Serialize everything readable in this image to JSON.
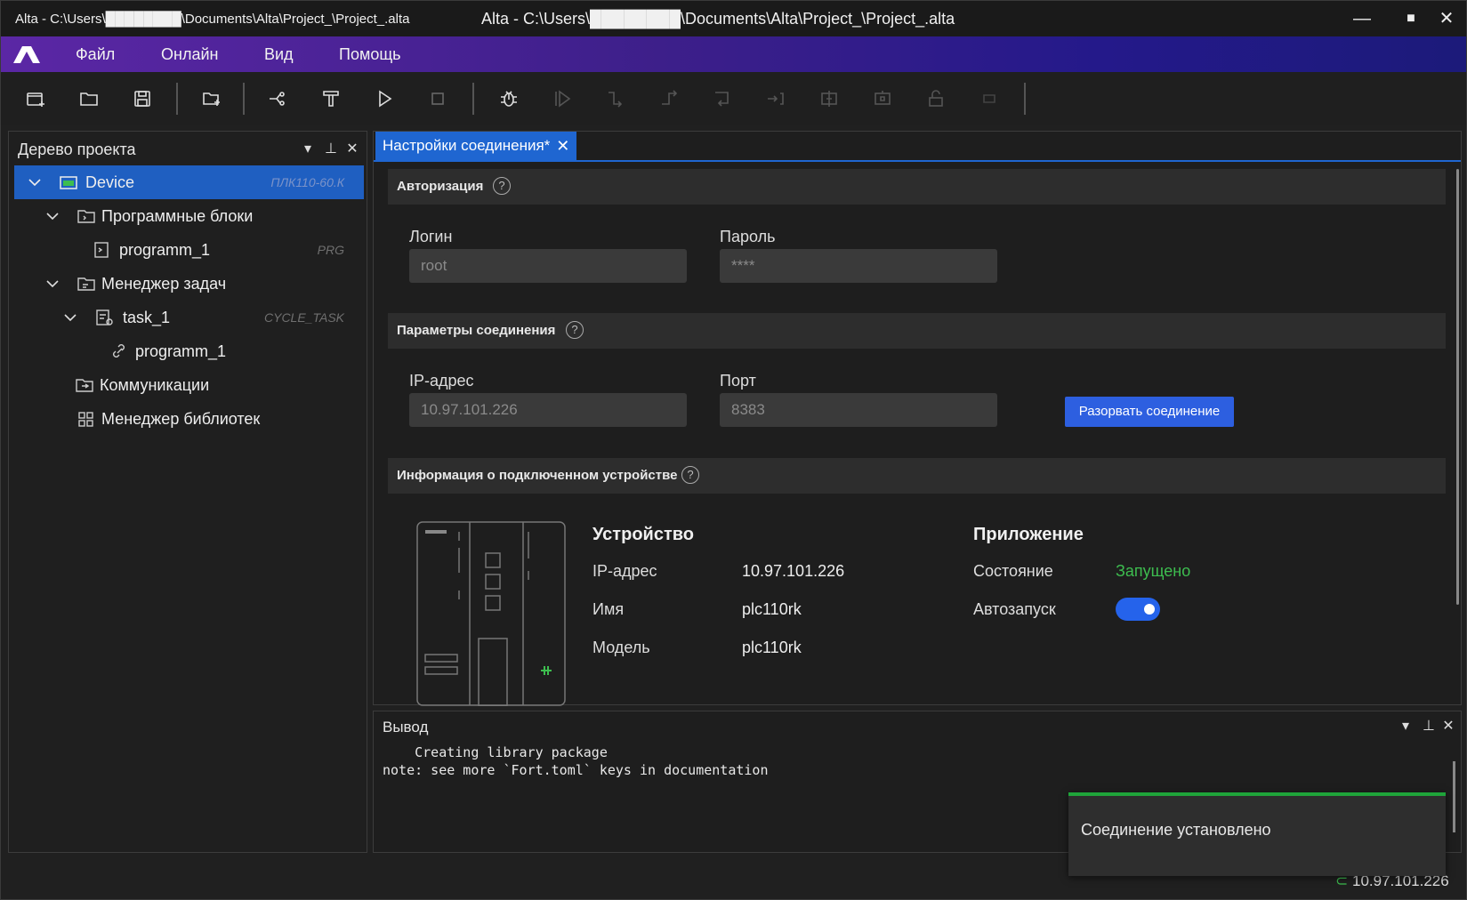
{
  "window": {
    "title_left": "Alta - C:\\Users\\████████\\Documents\\Alta\\Project_\\Project_.alta",
    "title_center": "Alta - C:\\Users\\████████\\Documents\\Alta\\Project_\\Project_.alta",
    "minimize": "—",
    "maximize": "■",
    "close": "✕"
  },
  "menu": {
    "items": [
      "Файл",
      "Онлайн",
      "Вид",
      "Помощь"
    ]
  },
  "toolbar": {
    "icons": [
      "new-project-icon",
      "open-folder-icon",
      "save-icon",
      "add-item-icon",
      "build-icon",
      "format-icon",
      "run-icon",
      "stop-icon",
      "debug-icon",
      "step-play-icon",
      "step-over-icon",
      "step-out-icon",
      "step-into-icon",
      "run-to-cursor-icon",
      "breakpoint-icon",
      "force-value-icon",
      "unlock-icon",
      "more-icon"
    ]
  },
  "project_tree": {
    "title": "Дерево проекта",
    "items": [
      {
        "label": "Device",
        "type": "ПЛК110-60.К"
      },
      {
        "label": "Программные блоки",
        "type": ""
      },
      {
        "label": "programm_1",
        "type": "PRG"
      },
      {
        "label": "Менеджер задач",
        "type": ""
      },
      {
        "label": "task_1",
        "type": "CYCLE_TASK"
      },
      {
        "label": "programm_1",
        "type": ""
      },
      {
        "label": "Коммуникации",
        "type": ""
      },
      {
        "label": "Менеджер библиотек",
        "type": ""
      }
    ]
  },
  "editor": {
    "tab": "Настройки соединения*",
    "tab_close": "✕",
    "help": "?",
    "auth": {
      "title": "Авторизация",
      "login_label": "Логин",
      "login_value": "root",
      "password_label": "Пароль",
      "password_value": "****"
    },
    "connection": {
      "title": "Параметры соединения",
      "ip_label": "IP-адрес",
      "ip_value": "10.97.101.226",
      "port_label": "Порт",
      "port_value": "8383",
      "disconnect_button": "Разорвать соединение"
    },
    "device_info": {
      "title": "Информация о подключенном устройстве",
      "device_heading": "Устройство",
      "ip_label": "IP-адрес",
      "ip_value": "10.97.101.226",
      "name_label": "Имя",
      "name_value": "plc110rk",
      "model_label": "Модель",
      "model_value": "plc110rk",
      "app_heading": "Приложение",
      "state_label": "Состояние",
      "state_value": "Запущено",
      "state_color": "#3dbd4f",
      "autostart_label": "Автозапуск",
      "autostart_on": true
    }
  },
  "output": {
    "title": "Вывод",
    "text": "    Creating library package\nnote: see more `Fort.toml` keys in documentation"
  },
  "toast": {
    "message": "Соединение установлено",
    "accent": "#1fa43a"
  },
  "status": {
    "ip": "10.97.101.226"
  },
  "colors": {
    "selection": "#1f5fc1",
    "accent": "#2d5fe0"
  }
}
